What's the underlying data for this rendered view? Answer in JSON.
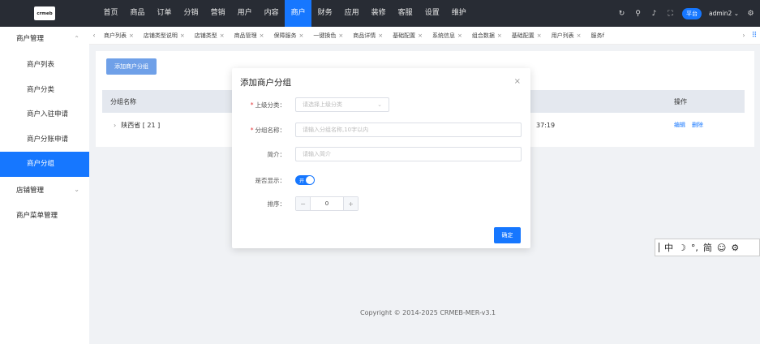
{
  "logo": {
    "text": "crmeb"
  },
  "topnav": {
    "items": [
      {
        "label": "首页",
        "active": false
      },
      {
        "label": "商品",
        "active": false
      },
      {
        "label": "订单",
        "active": false
      },
      {
        "label": "分销",
        "active": false
      },
      {
        "label": "营销",
        "active": false
      },
      {
        "label": "用户",
        "active": false
      },
      {
        "label": "内容",
        "active": false
      },
      {
        "label": "商户",
        "active": true
      },
      {
        "label": "财务",
        "active": false
      },
      {
        "label": "应用",
        "active": false
      },
      {
        "label": "装修",
        "active": false
      },
      {
        "label": "客服",
        "active": false
      },
      {
        "label": "设置",
        "active": false
      },
      {
        "label": "维护",
        "active": false
      }
    ],
    "platform_badge": "平台",
    "user_name": "admin2"
  },
  "sidebar": {
    "group1": "商户管理",
    "items": [
      {
        "label": "商户列表",
        "active": false
      },
      {
        "label": "商户分类",
        "active": false
      },
      {
        "label": "商户入驻申请",
        "active": false
      },
      {
        "label": "商户分账申请",
        "active": false
      },
      {
        "label": "商户分组",
        "active": true
      }
    ],
    "group2": "店铺管理",
    "group3": "商户菜单管理"
  },
  "tabs": [
    "商户列表",
    "店铺类型说明",
    "店铺类型",
    "商品管理",
    "保障服务",
    "一键换色",
    "商品详情",
    "基础配置",
    "系统信息",
    "组合数据",
    "基础配置",
    "用户列表",
    "服务f"
  ],
  "main": {
    "add_button": "添加商户分组",
    "col_name": "分组名称",
    "col_op": "操作",
    "row_name": "陕西省 [ 21 ]",
    "row_time": "37:19",
    "op_edit": "编辑",
    "op_delete": "删除"
  },
  "modal": {
    "title": "添加商户分组",
    "parent_label": "上级分类：",
    "parent_placeholder": "请选择上级分类",
    "name_label": "分组名称：",
    "name_placeholder": "请输入分组名称,10字以内",
    "desc_label": "简介：",
    "desc_placeholder": "请输入简介",
    "show_label": "是否显示：",
    "show_switch_text": "开",
    "sort_label": "排序：",
    "sort_value": "0",
    "confirm": "确定"
  },
  "copyright": "Copyright © 2014-2025 CRMEB-MER-v3.1",
  "ime": {
    "mode": "中",
    "punct": "°,",
    "simplified": "简"
  }
}
